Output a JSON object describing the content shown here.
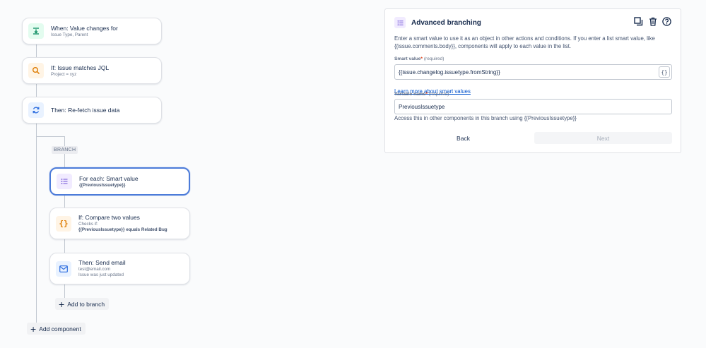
{
  "flow": {
    "trigger": {
      "title": "When: Value changes for",
      "subtitle": "Issue Type, Parent",
      "icon": "value-change-icon"
    },
    "condition": {
      "title": "If: Issue matches JQL",
      "subtitle": "Project = xyz",
      "icon": "search-icon"
    },
    "action": {
      "title": "Then: Re-fetch issue data",
      "icon": "refresh-icon"
    },
    "branch_tag": "BRANCH",
    "branch_items": [
      {
        "title": "For each: Smart value",
        "detail": "{{PreviousIssuetype}}",
        "icon": "list-icon"
      },
      {
        "title": "If: Compare two values",
        "subtitle": "Checks if:",
        "detail": "{{PreviousIssuetype}} equals Related Bug",
        "icon": "braces-icon"
      },
      {
        "title": "Then: Send email",
        "subtitle": "test@email.com",
        "subtitle2": "Issue was just updated",
        "icon": "mail-icon"
      }
    ],
    "add_to_branch": "Add to branch",
    "add_component": "Add component"
  },
  "panel": {
    "title": "Advanced branching",
    "description": "Enter a smart value to use it as an object in other actions and conditions. If you enter a list smart value, like {{issue.comments.body}}, components will apply to each value in the list.",
    "smart_value_label": "Smart value",
    "smart_value_required": "(required)",
    "smart_value": "{{issue.changelog.issuetype.fromString}}",
    "brace_button": "{}",
    "learn_more": "Learn more about smart values",
    "variable_label": "Variable name",
    "variable_required": "(required)",
    "variable_value": "PreviousIssuetype",
    "helper": "Access this in other components in this branch using {{PreviousIssuetype}}",
    "back": "Back",
    "next": "Next"
  },
  "colors": {
    "accent": "#4c7bd9",
    "link": "#0052cc"
  }
}
